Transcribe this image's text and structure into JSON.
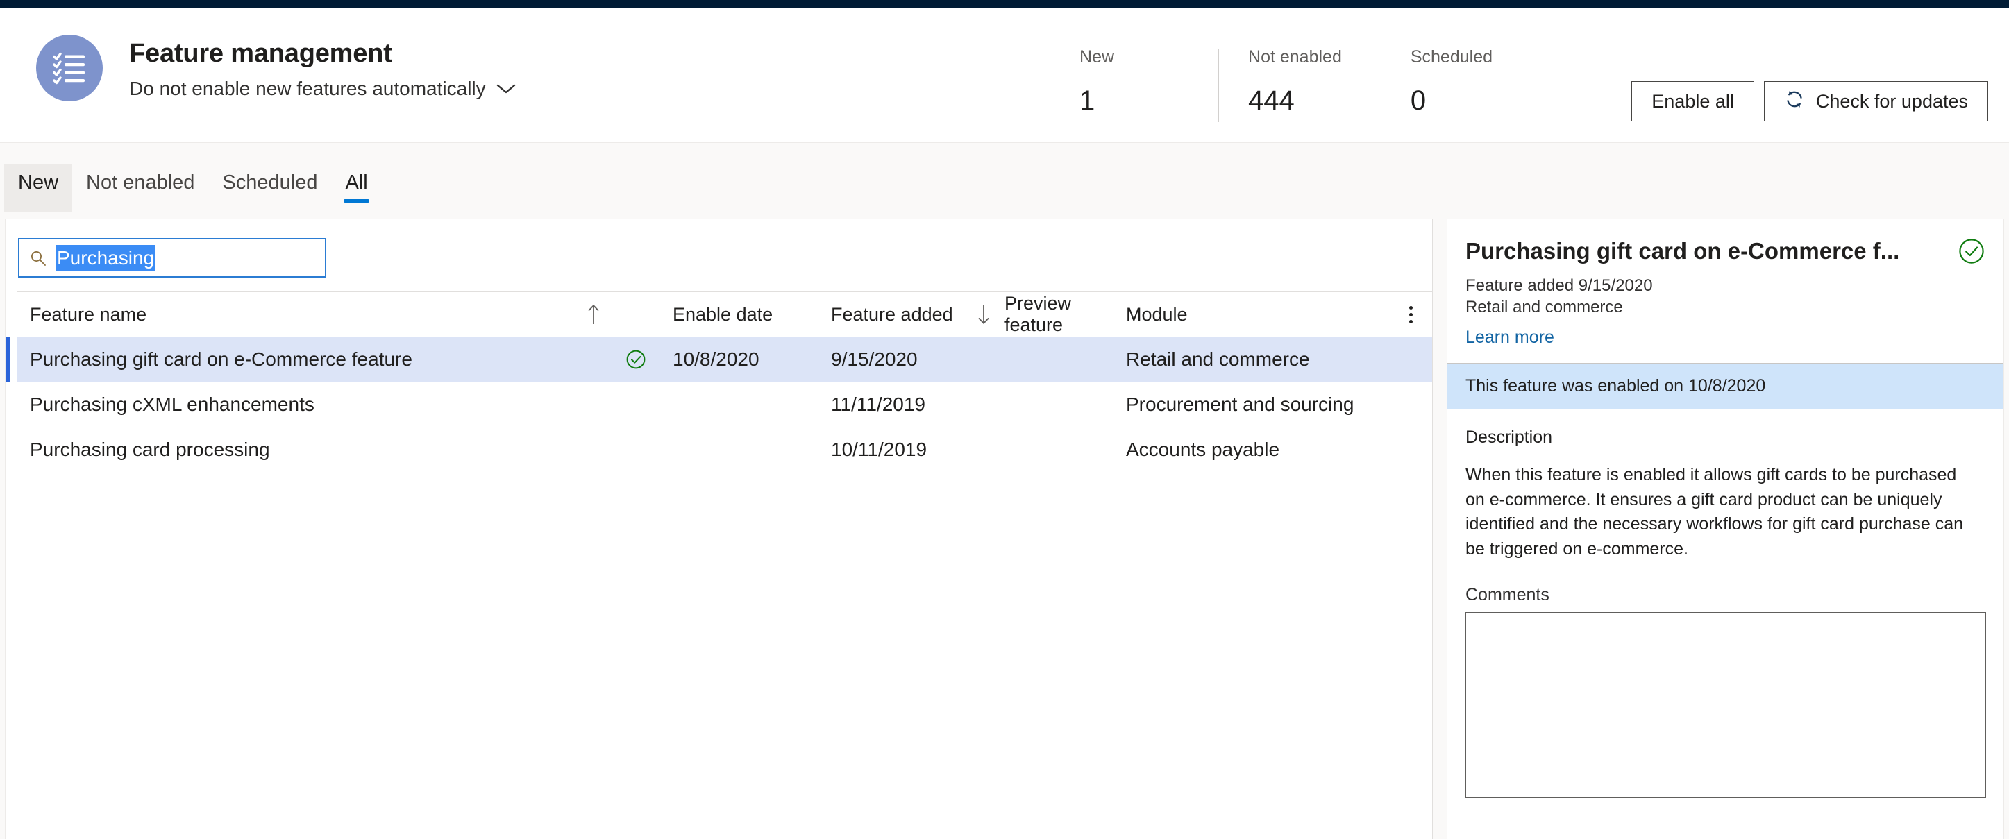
{
  "window": {
    "top_band_color": "#001b35",
    "page_background": "#faf9f8",
    "accent_color": "#0078d4",
    "selection_blue": "#3b8cf5",
    "row_selected_color": "#dce4f7",
    "status_green": "#107c10",
    "banner_blue": "#cfe4fa"
  },
  "header": {
    "avatar_icon": "checklist-icon",
    "title": "Feature management",
    "subtitle": "Do not enable new features automatically",
    "subtitle_chevron_icon": "chevron-down-icon",
    "stats": [
      {
        "label": "New",
        "value": "1"
      },
      {
        "label": "Not enabled",
        "value": "444"
      },
      {
        "label": "Scheduled",
        "value": "0"
      }
    ],
    "actions": [
      {
        "label": "Enable all",
        "icon": ""
      },
      {
        "label": "Check for updates",
        "icon": "refresh-icon"
      }
    ]
  },
  "tabs": [
    {
      "label": "New",
      "state": "hover"
    },
    {
      "label": "Not enabled",
      "state": "idle"
    },
    {
      "label": "Scheduled",
      "state": "idle"
    },
    {
      "label": "All",
      "state": "active"
    }
  ],
  "search": {
    "icon": "search-icon",
    "value": "Purchasing",
    "placeholder": "Filter",
    "selected": true
  },
  "table": {
    "columns": [
      {
        "key": "name",
        "label": "Feature name",
        "sort": "asc",
        "sort_icon": "arrow-up-icon"
      },
      {
        "key": "enabled_check",
        "label": ""
      },
      {
        "key": "enable_date",
        "label": "Enable date"
      },
      {
        "key": "feature_added",
        "label": "Feature added",
        "sort": "desc",
        "sort_icon": "arrow-down-icon"
      },
      {
        "key": "preview_feature",
        "label": "Preview feature"
      },
      {
        "key": "module",
        "label": "Module"
      }
    ],
    "overflow_menu_icon": "more-vertical-icon",
    "rows": [
      {
        "name": "Purchasing gift card on e-Commerce feature",
        "enabled": true,
        "enabled_icon": "check-circle-icon",
        "enable_date": "10/8/2020",
        "feature_added": "9/15/2020",
        "preview_feature": "",
        "module": "Retail and commerce",
        "selected": true
      },
      {
        "name": "Purchasing cXML enhancements",
        "enabled": false,
        "enabled_icon": "",
        "enable_date": "",
        "feature_added": "11/11/2019",
        "preview_feature": "",
        "module": "Procurement and sourcing",
        "selected": false
      },
      {
        "name": "Purchasing card processing",
        "enabled": false,
        "enabled_icon": "",
        "enable_date": "",
        "feature_added": "10/11/2019",
        "preview_feature": "",
        "module": "Accounts payable",
        "selected": false
      }
    ]
  },
  "detail": {
    "title": "Purchasing gift card on e-Commerce f...",
    "status_icon": "check-circle-icon",
    "feature_added": "Feature added 9/15/2020",
    "module": "Retail and commerce",
    "learn_more": "Learn more",
    "banner": "This feature was enabled on 10/8/2020",
    "description_label": "Description",
    "description": "When this feature is enabled it allows gift cards to be purchased on e-commerce. It ensures a gift card product can be uniquely identified and the necessary workflows for gift card purchase can be triggered on e-commerce.",
    "comments_label": "Comments",
    "comments_value": "",
    "comments_placeholder": ""
  }
}
